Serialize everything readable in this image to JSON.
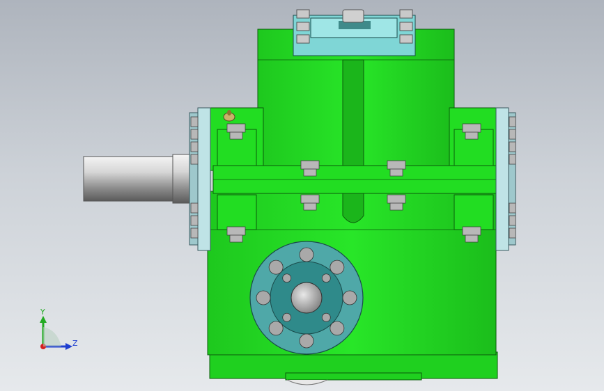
{
  "viewport": {
    "background_top": "#aeb4bd",
    "background_bottom": "#e6e9ec"
  },
  "model": {
    "housing_color": "#22dd22",
    "housing_edge_color": "#0b5a0b",
    "cover_color": "#7fd6d6",
    "flange_color": "#3c9e9e",
    "shaft_color": "#c8c8c8",
    "bolt_color": "#b8b8b8",
    "bearing_cap_color": "#bfe3e6",
    "icons": [
      "inspection-cover",
      "input-shaft",
      "output-flange",
      "fasteners",
      "oil-plug"
    ]
  },
  "triad": {
    "y_label": "Y",
    "z_label": "Z",
    "y_color": "#22aa22",
    "z_color": "#1f3fd0",
    "x_color": "#d42020"
  }
}
